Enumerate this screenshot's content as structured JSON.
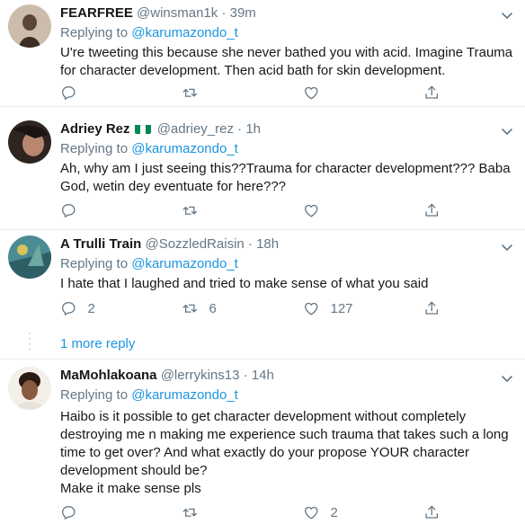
{
  "tweets": [
    {
      "name": "FEARFREE",
      "handle": "@winsman1k",
      "sep": "·",
      "time": "39m",
      "replying_prefix": "Replying to ",
      "replying_to": "@karumazondo_t",
      "text": "U're tweeting this because she never bathed you with acid. Imagine Trauma\nfor character development. Then acid bath for skin development.",
      "reply_count": "",
      "retweet_count": "",
      "like_count": "",
      "avatar_colors": [
        "#c9b8a6",
        "#4a3a30"
      ]
    },
    {
      "name": "Adriey Rez",
      "flag": [
        "#008751",
        "#ffffff",
        "#008751"
      ],
      "handle": "@adriey_rez",
      "sep": "·",
      "time": "1h",
      "replying_prefix": "Replying to ",
      "replying_to": "@karumazondo_t",
      "text": "Ah, why am I just seeing this??Trauma for character development??? Baba\nGod, wetin  dey eventuate for here???",
      "reply_count": "",
      "retweet_count": "",
      "like_count": "",
      "avatar_colors": [
        "#2a1f1c",
        "#b98670"
      ]
    },
    {
      "name": "A Trulli Train",
      "handle": "@SozzledRaisin",
      "sep": "·",
      "time": "18h",
      "replying_prefix": "Replying to ",
      "replying_to": "@karumazondo_t",
      "text": "I hate that I laughed and tried to make sense of what you said",
      "reply_count": "2",
      "retweet_count": "6",
      "like_count": "127",
      "avatar_colors": [
        "#3d7a8a",
        "#d8c25a"
      ]
    },
    {
      "name": "MaMohlakoana",
      "handle": "@lerrykins13",
      "sep": "·",
      "time": "14h",
      "replying_prefix": "Replying to ",
      "replying_to": "@karumazondo_t",
      "text": "Haibo is it possible to get character development without completely\ndestroying me n making me experience such trauma that takes such a long\ntime to get over? And what exactly do your propose YOUR character\ndevelopment should be?\nMake it make sense pls",
      "reply_count": "",
      "retweet_count": "",
      "like_count": "2",
      "avatar_colors": [
        "#f2ece6",
        "#5a3a2a"
      ]
    }
  ],
  "more_replies": "1 more reply",
  "icons": {
    "reply": "reply-icon",
    "retweet": "retweet-icon",
    "like": "like-icon",
    "share": "share-icon",
    "caret": "chevron-down-icon"
  },
  "colors": {
    "link": "#1b95e0",
    "secondary": "#657786",
    "divider": "#e6ecf0"
  }
}
